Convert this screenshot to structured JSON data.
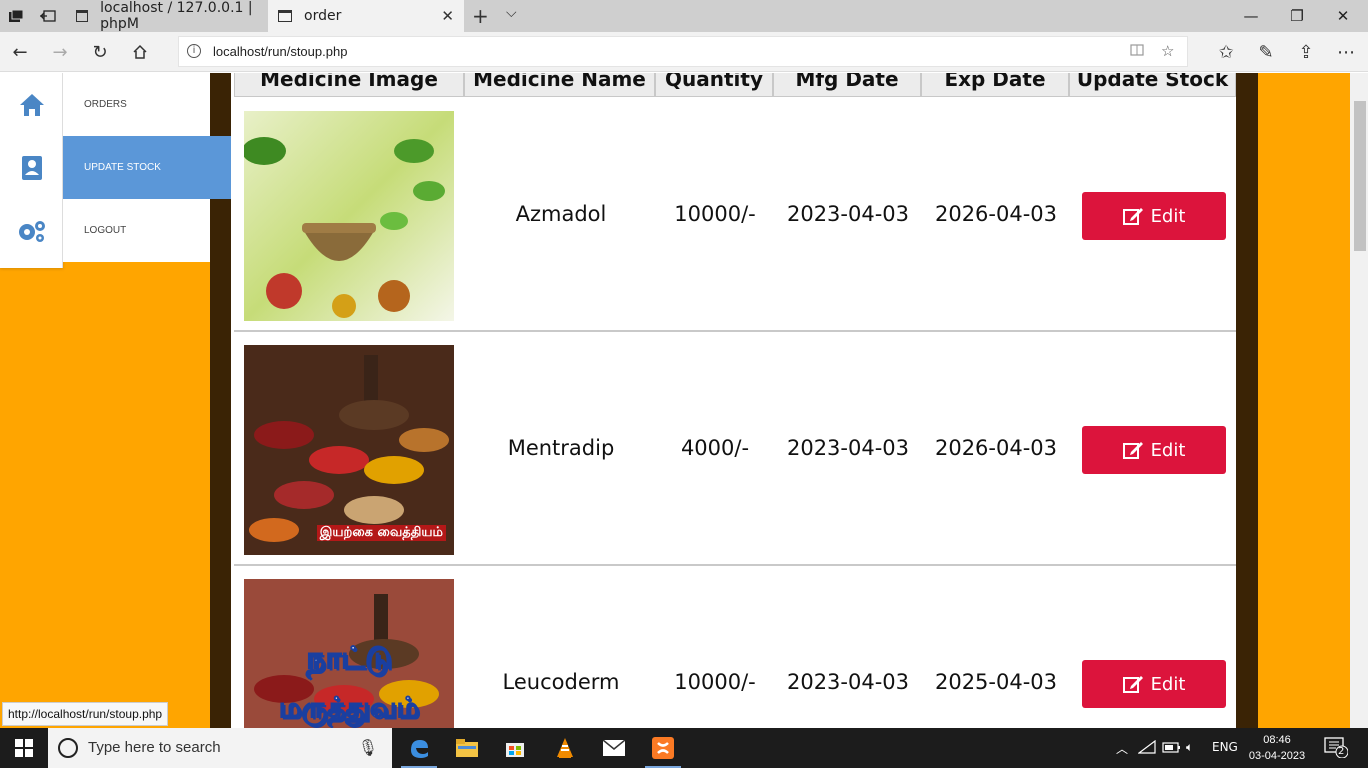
{
  "browser": {
    "tabs": [
      {
        "title": "localhost / 127.0.0.1 | phpM",
        "active": false
      },
      {
        "title": "order",
        "active": true
      }
    ],
    "url": "localhost/run/stoup.php"
  },
  "sidebar": {
    "items": [
      {
        "label": "ORDERS",
        "icon": "home-icon",
        "active": false
      },
      {
        "label": "UPDATE STOCK",
        "icon": "contact-card-icon",
        "active": true
      },
      {
        "label": "LOGOUT",
        "icon": "gears-icon",
        "active": false
      }
    ]
  },
  "table": {
    "headers": [
      "Medicine Image",
      "Medicine Name",
      "Quantity",
      "Mfg Date",
      "Exp Date",
      "Update Stock"
    ],
    "rows": [
      {
        "image": "herbs-mortar-image",
        "name": "Azmadol",
        "quantity": "10000/-",
        "mfg": "2023-04-03",
        "exp": "2026-04-03",
        "action": "Edit"
      },
      {
        "image": "spice-bowls-image",
        "name": "Mentradip",
        "quantity": "4000/-",
        "mfg": "2023-04-03",
        "exp": "2026-04-03",
        "action": "Edit",
        "image_caption": "இயற்கை வைத்தியம்"
      },
      {
        "image": "natural-medicine-image",
        "name": "Leucoderm",
        "quantity": "10000/-",
        "mfg": "2023-04-03",
        "exp": "2025-04-03",
        "action": "Edit",
        "image_caption_line1": "நாட்டு",
        "image_caption_line2": "மருத்துவம்"
      }
    ]
  },
  "status_link": "http://localhost/run/stoup.php",
  "taskbar": {
    "search_placeholder": "Type here to search",
    "language": "ENG",
    "time": "08:46",
    "date": "03-04-2023",
    "notifications": "2"
  },
  "colors": {
    "page_bg": "#FFA500",
    "accent_active": "#5b97d8",
    "edit_button": "#dc143c",
    "dark_border": "#3a2305"
  }
}
